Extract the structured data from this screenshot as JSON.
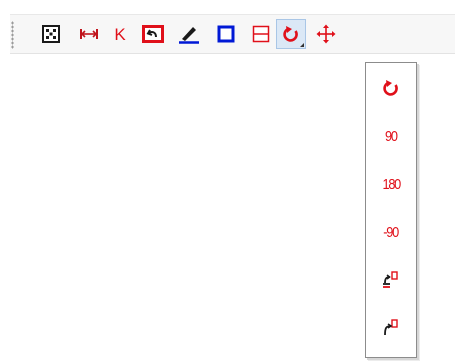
{
  "toolbar": {
    "buttons": [
      {
        "name": "grid-icon"
      },
      {
        "name": "fit-width-icon"
      },
      {
        "name": "k-icon"
      },
      {
        "name": "reset-view-icon"
      },
      {
        "name": "pen-icon"
      },
      {
        "name": "rectangle-icon"
      },
      {
        "name": "split-horizontal-icon"
      },
      {
        "name": "rotate-icon",
        "active": true,
        "has_dropdown": true
      },
      {
        "name": "move-icon"
      }
    ],
    "k_label": "K"
  },
  "rotate_menu": {
    "items": [
      {
        "name": "rotate-icon"
      },
      {
        "label": "90"
      },
      {
        "label": "180"
      },
      {
        "label": "-90"
      },
      {
        "name": "flip-rotate-left-icon"
      },
      {
        "name": "rotate-left-icon"
      }
    ]
  },
  "colors": {
    "red": "#e0101a",
    "blue": "#0019d6",
    "dark": "#1a1a1a",
    "active_bg": "#dbe8f6"
  }
}
